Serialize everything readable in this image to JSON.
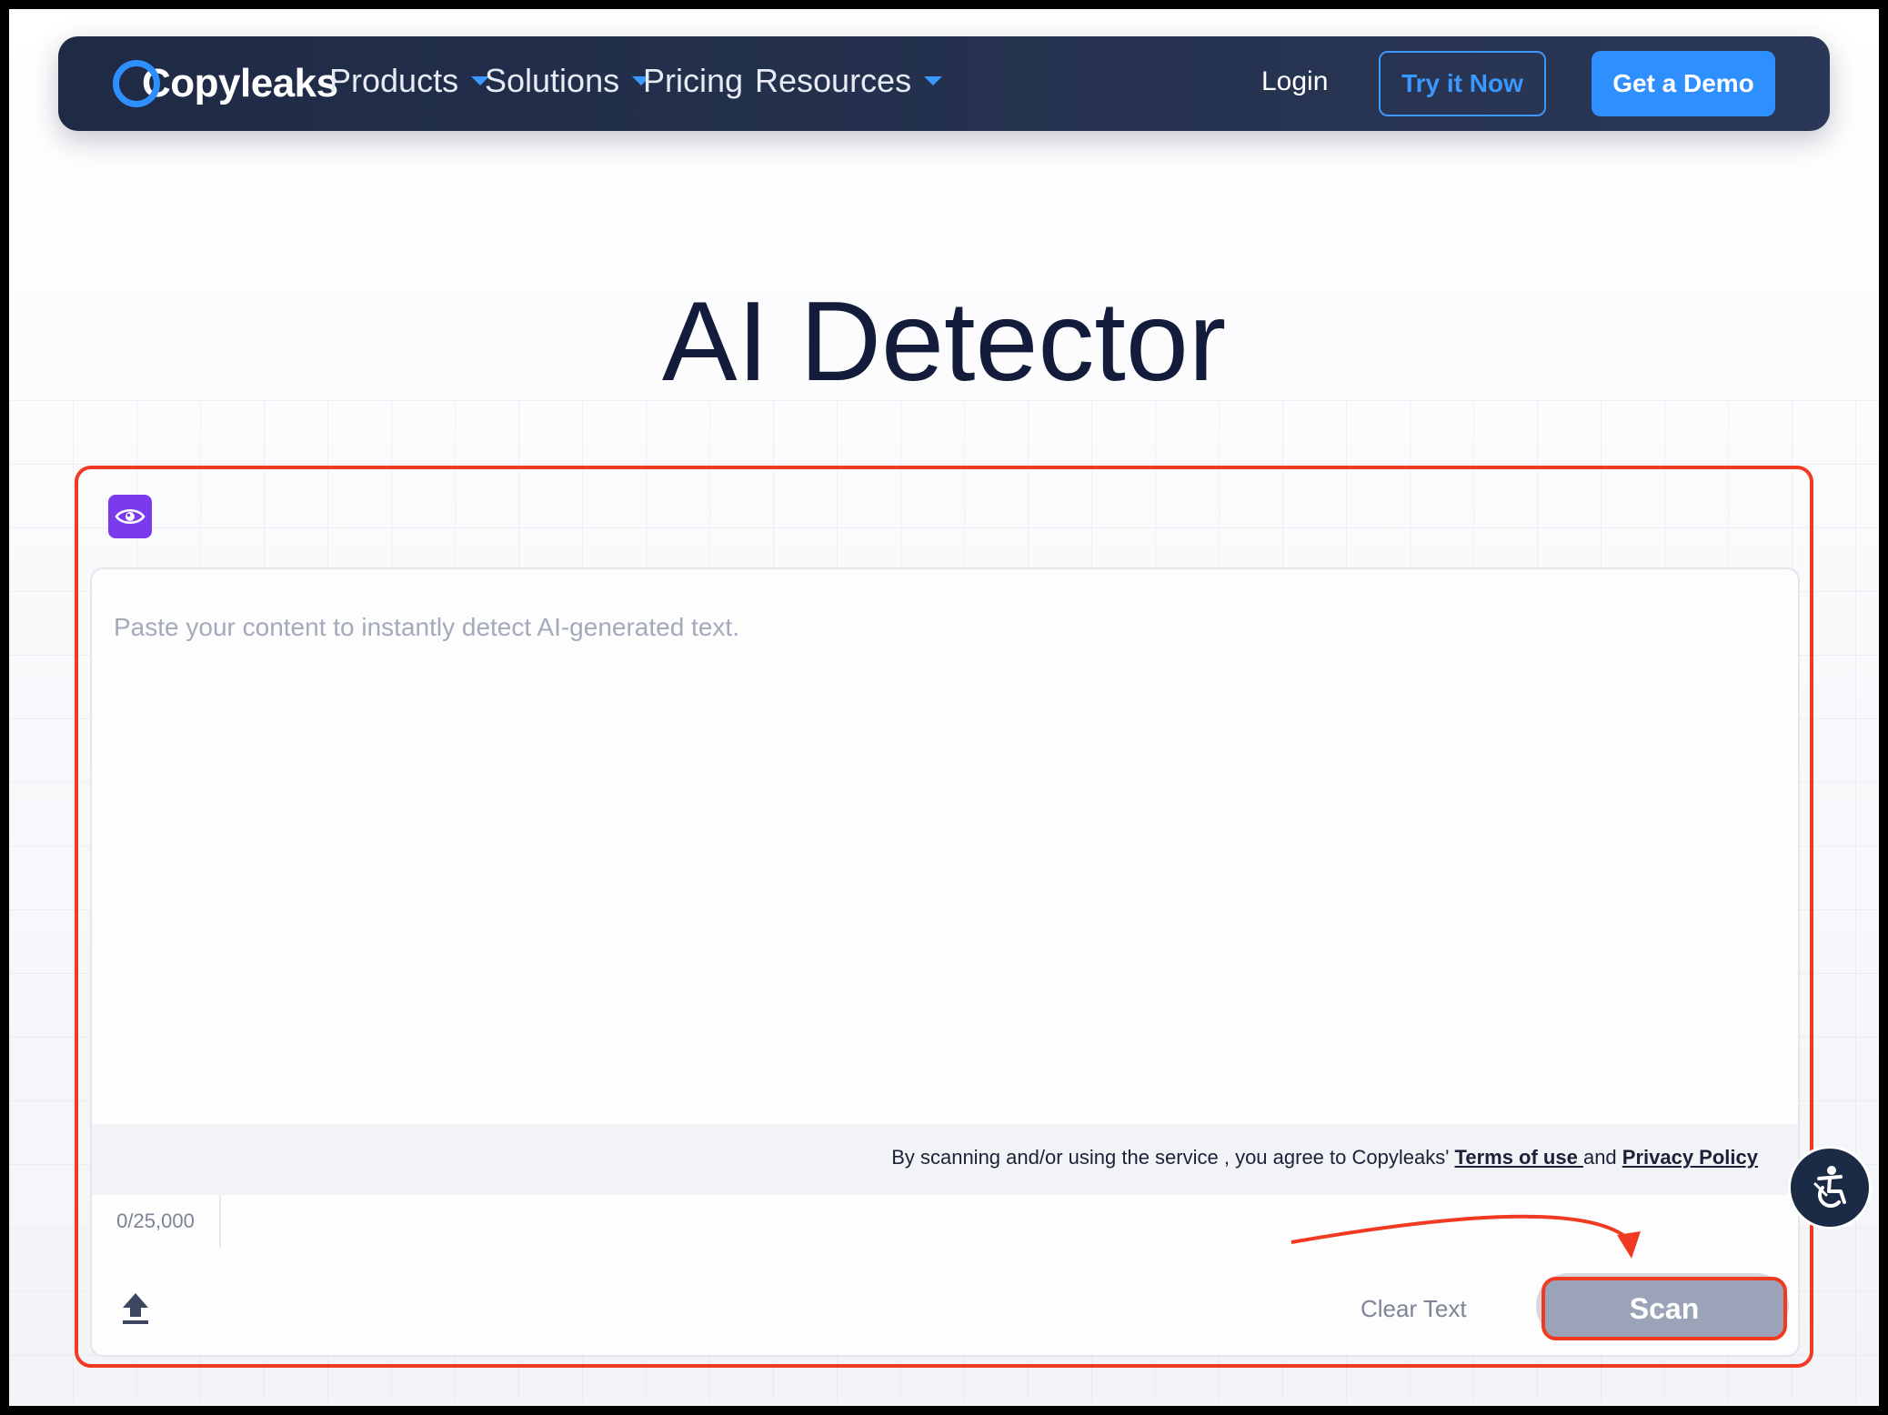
{
  "nav": {
    "logo_text": "Copyleaks",
    "items": [
      {
        "label": "Products",
        "has_dropdown": true
      },
      {
        "label": "Solutions",
        "has_dropdown": true
      },
      {
        "label": "Pricing",
        "has_dropdown": false
      },
      {
        "label": "Resources",
        "has_dropdown": true
      }
    ],
    "login_label": "Login",
    "try_label": "Try it Now",
    "demo_label": "Get a Demo"
  },
  "page_title": "AI Detector",
  "editor": {
    "placeholder": "Paste your content to instantly detect AI-generated text.",
    "terms_prefix": "By scanning and/or using the service , you agree to Copyleaks' ",
    "terms_link": "Terms of use ",
    "terms_and": "and ",
    "privacy_link": "Privacy Policy",
    "counter": "0/25,000",
    "clear_label": "Clear Text",
    "scan_label": "Scan"
  },
  "icons": {
    "eye": "eye-icon",
    "upload": "upload-icon",
    "accessibility": "accessibility-icon"
  },
  "colors": {
    "nav_bg": "#1f2b45",
    "accent": "#2f8fff",
    "annotation_red": "#f03a21",
    "eye_button": "#7c3aed",
    "scan_disabled": "#9aa3b8"
  }
}
